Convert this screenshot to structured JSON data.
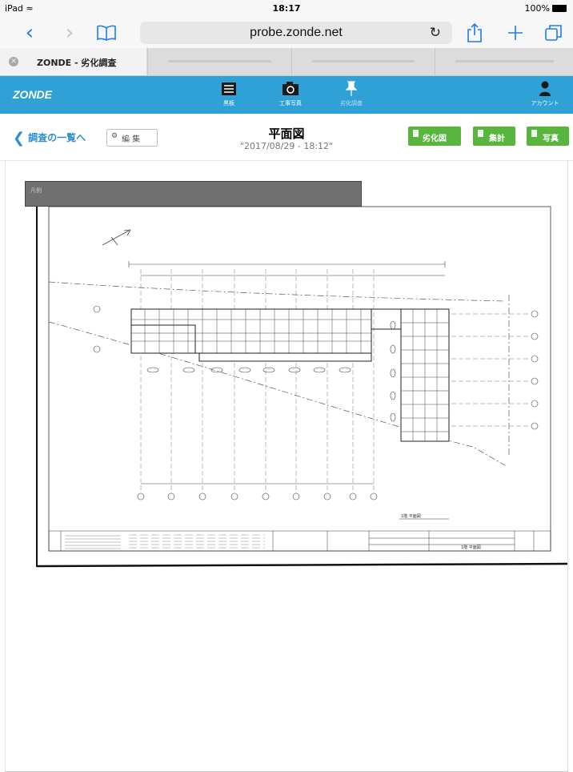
{
  "status_bar": {
    "device": "iPad",
    "time": "18:17",
    "battery": "100%"
  },
  "browser": {
    "url": "probe.zonde.net",
    "tabs": [
      {
        "title": "ZONDE - 劣化調査",
        "active": true
      },
      {
        "title": "",
        "active": false
      },
      {
        "title": "",
        "active": false
      },
      {
        "title": "",
        "active": false
      }
    ]
  },
  "app_nav": {
    "logo": "ZONDE",
    "items": [
      {
        "label": "黒板",
        "icon": "blackboard-icon"
      },
      {
        "label": "工事写真",
        "icon": "camera-icon"
      },
      {
        "label": "劣化調査",
        "icon": "pin-icon"
      },
      {
        "label": "アカウント",
        "icon": "account-icon"
      }
    ]
  },
  "subheader": {
    "back_label": "調査の一覧へ",
    "edit_label": "編 集",
    "title": "平面図",
    "subtitle": "\"2017/08/29 - 18:12\"",
    "buttons": [
      "劣化図",
      "集計",
      "写真"
    ]
  },
  "drawing": {
    "legend_label": "凡例",
    "plan_caption": "1階 平面図",
    "titleblock_caption": "1階 平面図"
  },
  "colors": {
    "nav_bg": "#2fa1d7",
    "green_button": "#58b53d",
    "ios_blue": "#1a7cf6",
    "back_link": "#2b8fd0"
  }
}
